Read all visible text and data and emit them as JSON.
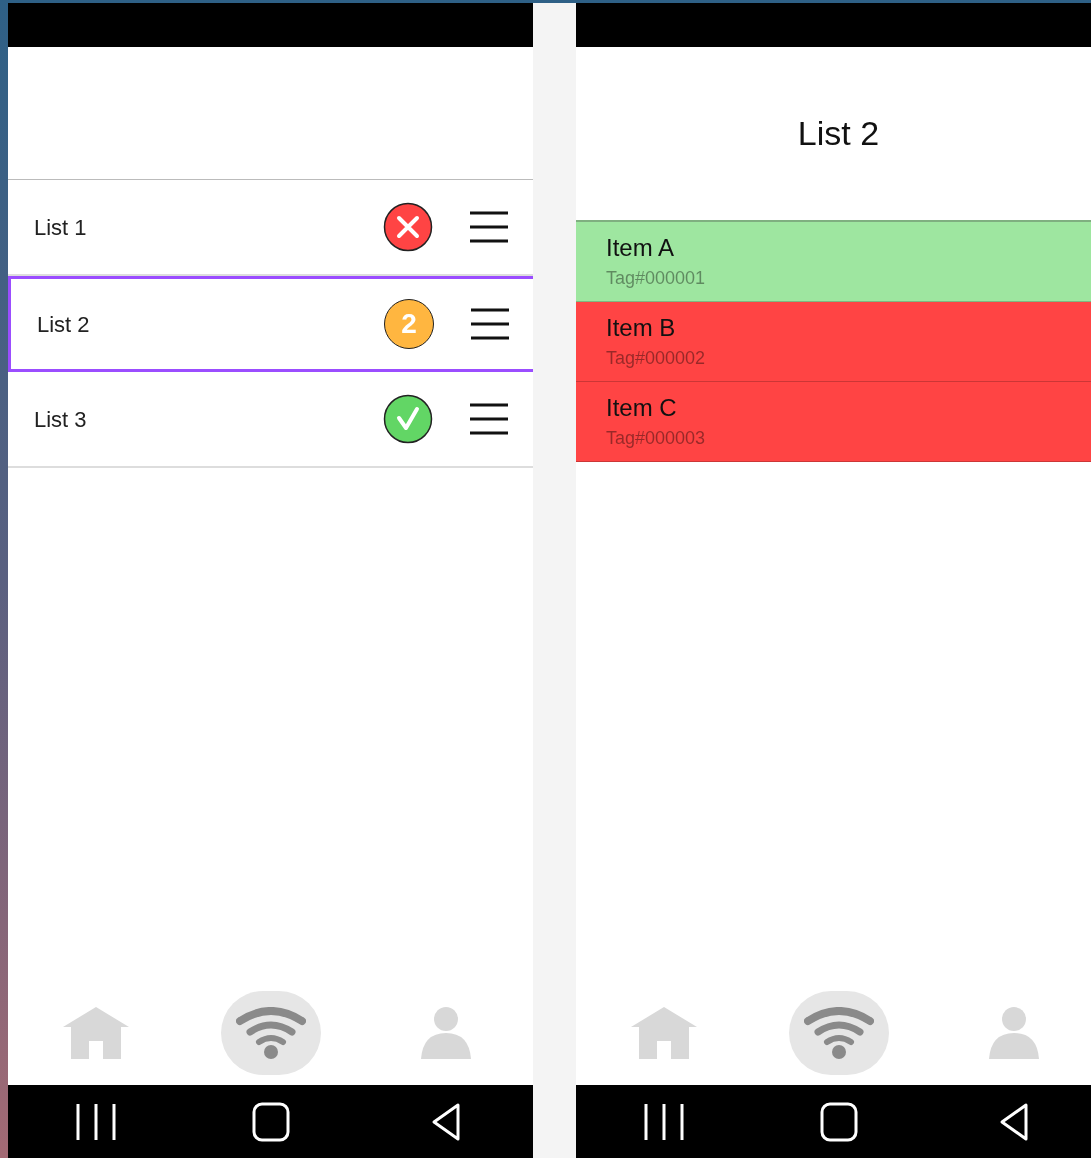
{
  "lists_screen": {
    "lists": [
      {
        "label": "List 1",
        "status": {
          "kind": "error"
        },
        "selected": false
      },
      {
        "label": "List 2",
        "status": {
          "kind": "count",
          "text": "2"
        },
        "selected": true
      },
      {
        "label": "List 3",
        "status": {
          "kind": "done"
        },
        "selected": false
      }
    ],
    "bottom_tabs": [
      {
        "kind": "home",
        "selected": false
      },
      {
        "kind": "wifi",
        "selected": true
      },
      {
        "kind": "person",
        "selected": false
      }
    ]
  },
  "detail_screen": {
    "title": "List 2",
    "items": [
      {
        "name": "Item A",
        "tag": "Tag#000001",
        "color": "#9ee6a0"
      },
      {
        "name": "Item B",
        "tag": "Tag#000002",
        "color": "#ff4444"
      },
      {
        "name": "Item C",
        "tag": "Tag#000003",
        "color": "#ff4444"
      }
    ],
    "bottom_tabs": [
      {
        "kind": "home",
        "selected": false
      },
      {
        "kind": "wifi",
        "selected": true
      },
      {
        "kind": "person",
        "selected": false
      }
    ]
  }
}
